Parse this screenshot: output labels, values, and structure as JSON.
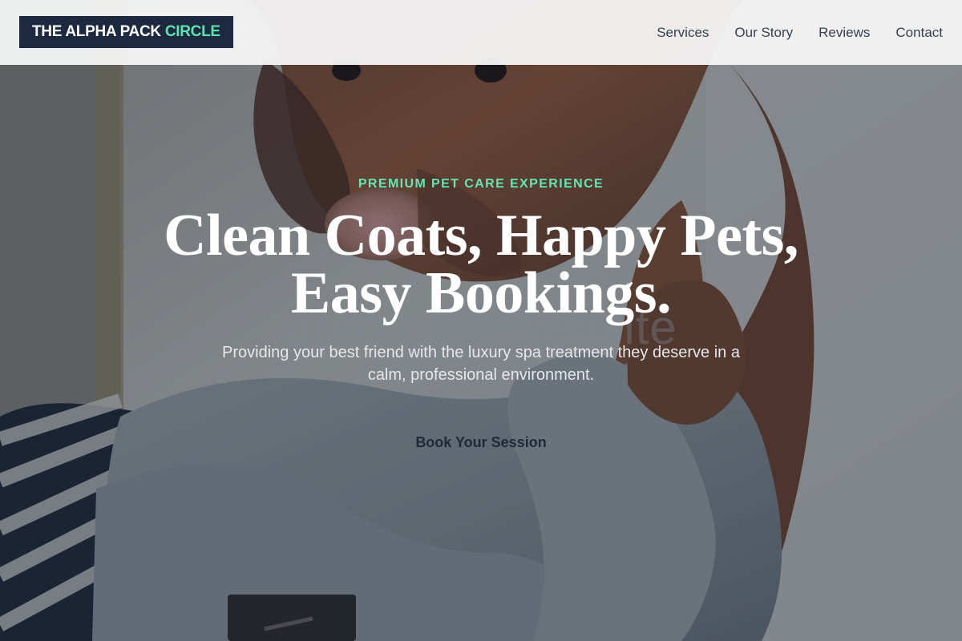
{
  "header": {
    "brand": {
      "main": "THE ALPHA PACK",
      "accent": "CIRCLE"
    },
    "nav": [
      {
        "label": "Services"
      },
      {
        "label": "Our Story"
      },
      {
        "label": "Reviews"
      },
      {
        "label": "Contact"
      }
    ]
  },
  "hero": {
    "eyebrow": "PREMIUM PET CARE EXPERIENCE",
    "title_lines": [
      "Clean Coats, Happy Pets,",
      "Easy Bookings."
    ],
    "subtitle": "Providing your best friend with the luxury spa treatment they deserve in a calm, professional environment.",
    "cta": "Book Your Session",
    "watermark": "groomers.website"
  },
  "colors": {
    "header_background": "#f6f6f7",
    "brand_background": "#1d2940",
    "brand_accent": "#5ee3ae",
    "nav_text": "#364152",
    "eyebrow": "#63e5b4",
    "hero_title": "#ffffff",
    "cta_text": "#1f2937"
  },
  "icons": {
    "hero_image": "dog-grooming-photo"
  }
}
